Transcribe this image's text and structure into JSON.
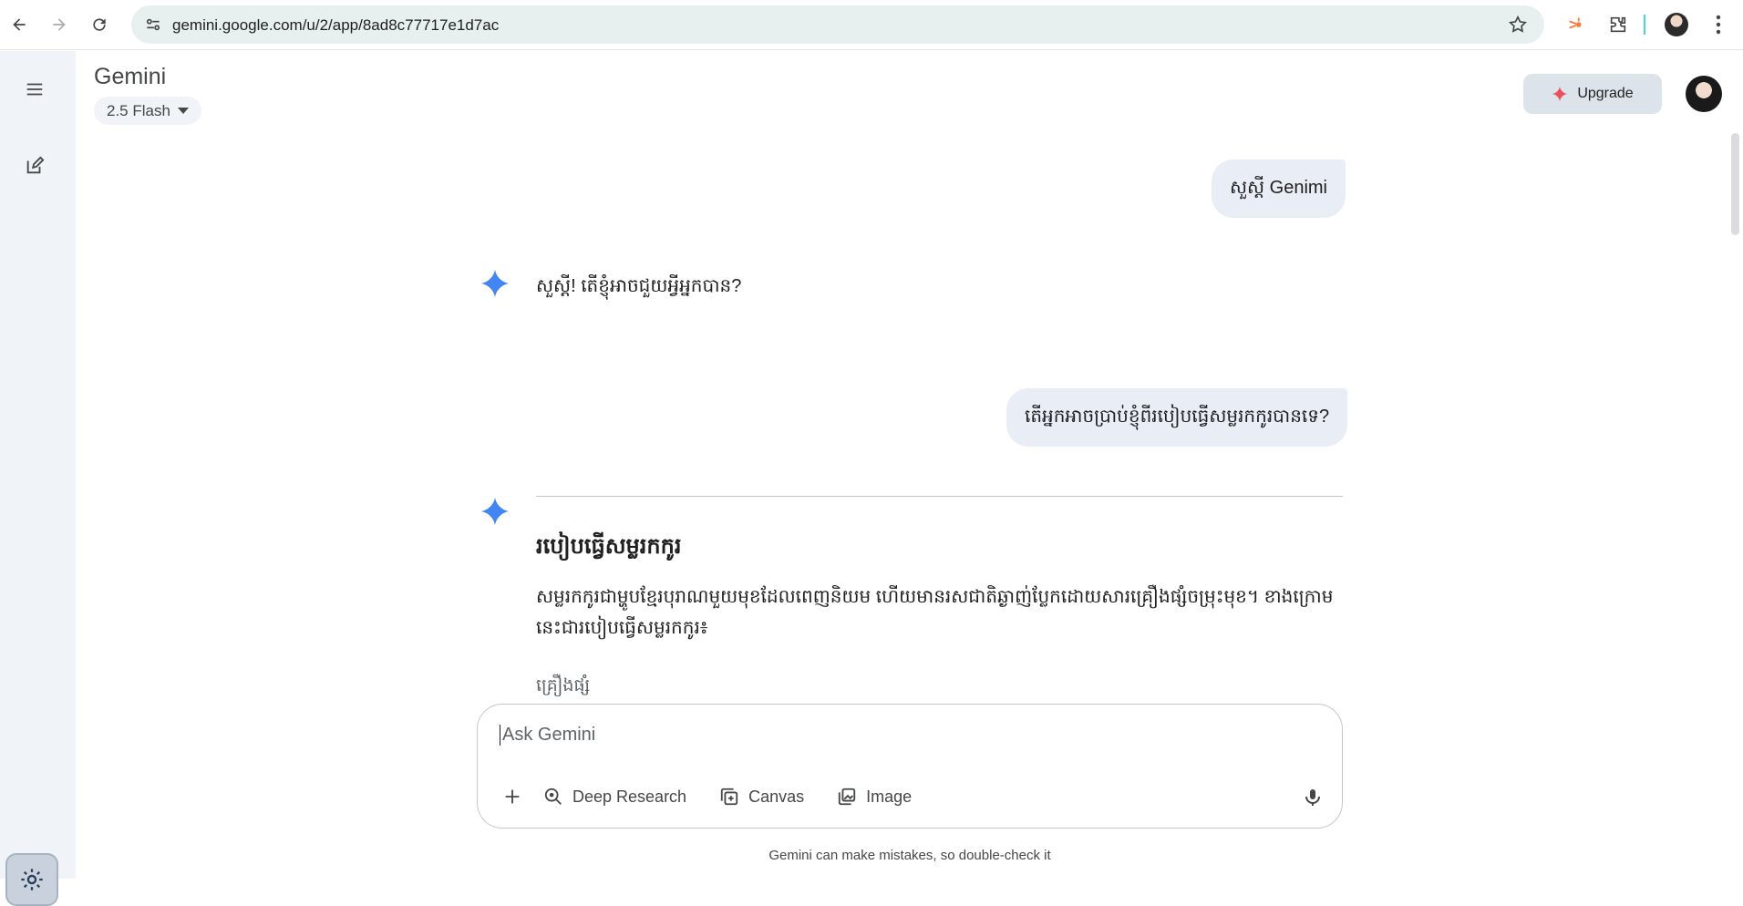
{
  "browser": {
    "url": "gemini.google.com/u/2/app/8ad8c77717e1d7ac"
  },
  "header": {
    "title": "Gemini",
    "model": "2.5 Flash",
    "upgrade_label": "Upgrade"
  },
  "chat": {
    "messages": [
      {
        "role": "user",
        "text": "សួស្តី Genimi"
      },
      {
        "role": "model",
        "text": "សួស្តី! តើខ្ញុំអាចជួយអ្វីអ្នកបាន?"
      },
      {
        "role": "user",
        "text": "តើអ្នកអាចប្រាប់ខ្ញុំពីរបៀបធ្វើសម្លរកកូរបានទេ?"
      }
    ],
    "response": {
      "heading": "របៀបធ្វើសម្លរកកូរ",
      "paragraph": "សម្លរកកូរជាម្ហូបខ្មែរបុរាណមួយមុខដែលពេញនិយម ហើយមានរសជាតិឆ្ងាញ់ប្លែកដោយសារគ្រឿងផ្សំចម្រុះមុខ។ ខាងក្រោមនេះជារបៀបធ្វើសម្លរកកូរ៖",
      "subheading": "គ្រឿងផ្សំ"
    }
  },
  "composer": {
    "placeholder": "Ask Gemini",
    "tools": {
      "deep_research": "Deep Research",
      "canvas": "Canvas",
      "image": "Image"
    }
  },
  "footer": {
    "note": "Gemini can make mistakes, so double-check it"
  },
  "colors": {
    "spark_blue": "#4285f4",
    "upgrade_star": "#e8505b",
    "rail_bg": "#f0f4f9"
  }
}
